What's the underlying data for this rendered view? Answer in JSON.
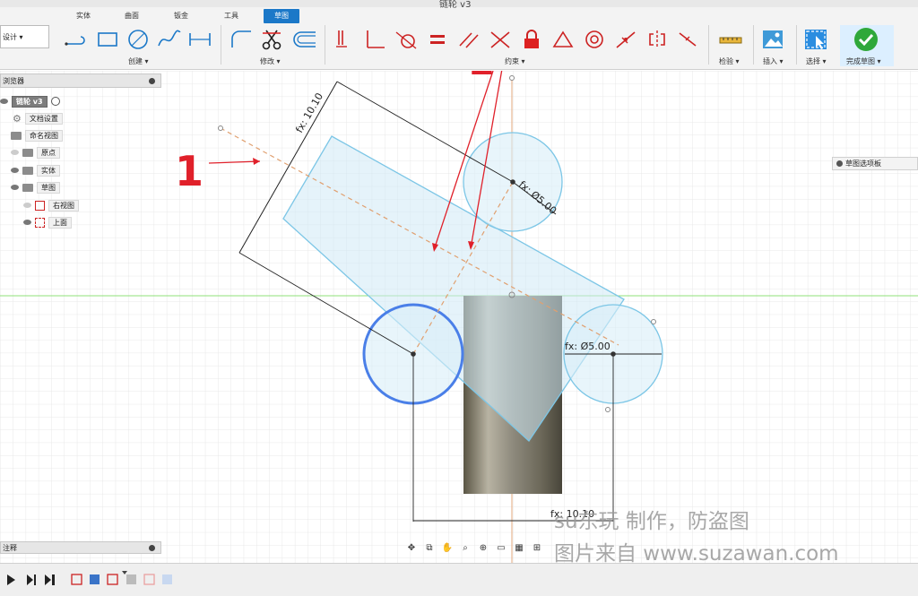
{
  "window": {
    "title": "链轮 v3"
  },
  "tabs": [
    {
      "label": "实体",
      "active": false
    },
    {
      "label": "曲面",
      "active": false
    },
    {
      "label": "钣金",
      "active": false
    },
    {
      "label": "工具",
      "active": false
    },
    {
      "label": "草图",
      "active": true
    }
  ],
  "workspace": {
    "label": "设计 ▾"
  },
  "groups": {
    "create": "创建 ▾",
    "modify": "修改 ▾",
    "constrain": "约束 ▾",
    "inspect": "检验 ▾",
    "insert": "插入 ▾",
    "select": "选择 ▾",
    "finish": "完成草图 ▾"
  },
  "browser": {
    "title": "浏览器",
    "root": "链轮 v3",
    "items": [
      "文档设置",
      "命名视图",
      "原点",
      "实体",
      "草图"
    ],
    "sketches": [
      "右视图",
      "上面"
    ]
  },
  "palette": {
    "label": "草图选项板"
  },
  "comments": {
    "label": "注释"
  },
  "dimensions": {
    "diag": "fx: 10.10",
    "dia_top": "fx: Ø5.00",
    "dia_right": "fx: Ø5.00",
    "bottom": "fx: 10.10"
  },
  "annotations": {
    "one": "1",
    "two": "2"
  },
  "watermark": {
    "line1": "su东玩 制作，防盗图",
    "line2": "图片来自 www.suzawan.com"
  },
  "colors": {
    "accent": "#1b78c8",
    "sketch": "#7cc6e6",
    "annotation": "#e0202a",
    "selected_circle": "#4a7fe8"
  }
}
